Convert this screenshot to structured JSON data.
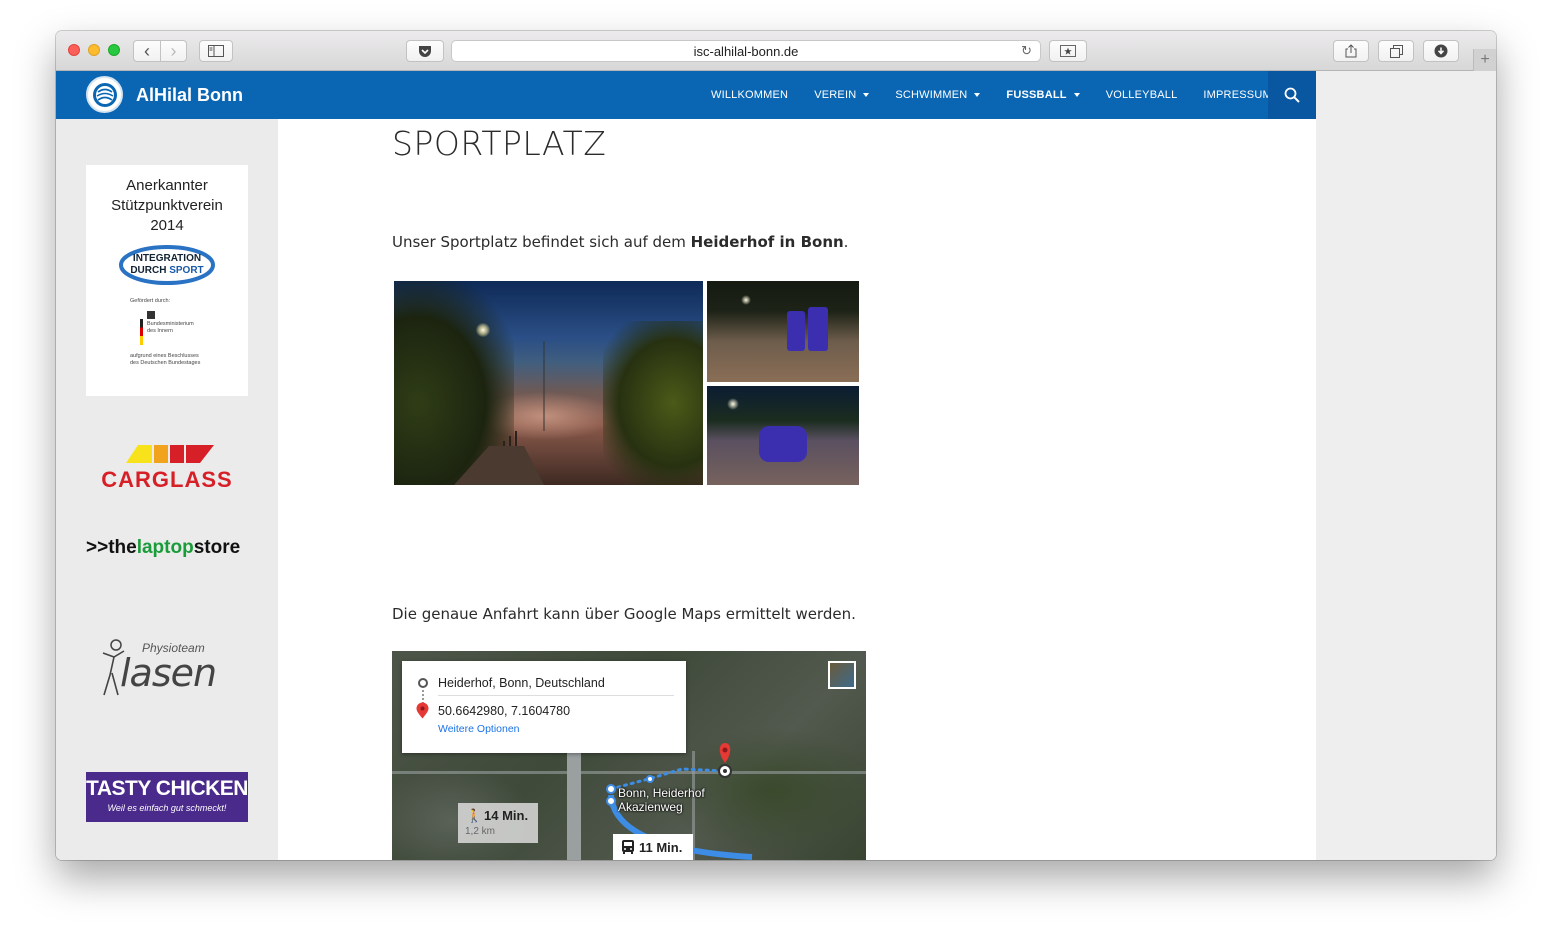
{
  "browser": {
    "url": "isc-alhilal-bonn.de",
    "buttons": {
      "back": "‹",
      "forward": "›",
      "new_tab": "+"
    }
  },
  "site": {
    "title": "AlHilal Bonn",
    "menu": [
      {
        "label": "WILLKOMMEN",
        "has_dropdown": false
      },
      {
        "label": "VEREIN",
        "has_dropdown": true
      },
      {
        "label": "SCHWIMMEN",
        "has_dropdown": true
      },
      {
        "label": "FUSSBALL",
        "has_dropdown": true,
        "active": true
      },
      {
        "label": "VOLLEYBALL",
        "has_dropdown": false
      },
      {
        "label": "IMPRESSUM",
        "has_dropdown": false
      }
    ],
    "brand_color": "#0a66b3"
  },
  "sidebar": {
    "badge": {
      "title": "Anerkannter Stützpunktverein 2014",
      "logo_line1": "INTEGRATION",
      "logo_line2_a": "DURCH ",
      "logo_line2_b": "SPORT",
      "funded_by": "Gefördert durch:",
      "ministry": "Bundesministerium des Innern",
      "resolution": "aufgrund eines Beschlusses des Deutschen Bundestages"
    },
    "sponsors": {
      "carglass": "CARGLASS",
      "laptop_a": ">>the",
      "laptop_b": "laptop",
      "laptop_c": "store",
      "physio_small": "Physioteam",
      "physio_big": "lasen",
      "tasty_main": "TASTY CHICKEN",
      "tasty_sub": "Weil es einfach gut schmeckt!"
    }
  },
  "main": {
    "title": "SPORTPLATZ",
    "para1_before": "Unser Sportplatz befindet sich auf dem ",
    "para1_bold": "Heiderhof in Bonn",
    "para1_after": ".",
    "para2": "Die genaue Anfahrt kann über Google Maps ermittelt werden."
  },
  "map": {
    "origin": "Heiderhof, Bonn, Deutschland",
    "destination": "50.6642980, 7.1604780",
    "more_options": "Weitere Optionen",
    "stop_label_1": "Bonn, Heiderhof",
    "stop_label_2": "Akazienweg",
    "walk_time": "14 Min.",
    "walk_distance": "1,2 km",
    "transit_time": "11 Min."
  }
}
